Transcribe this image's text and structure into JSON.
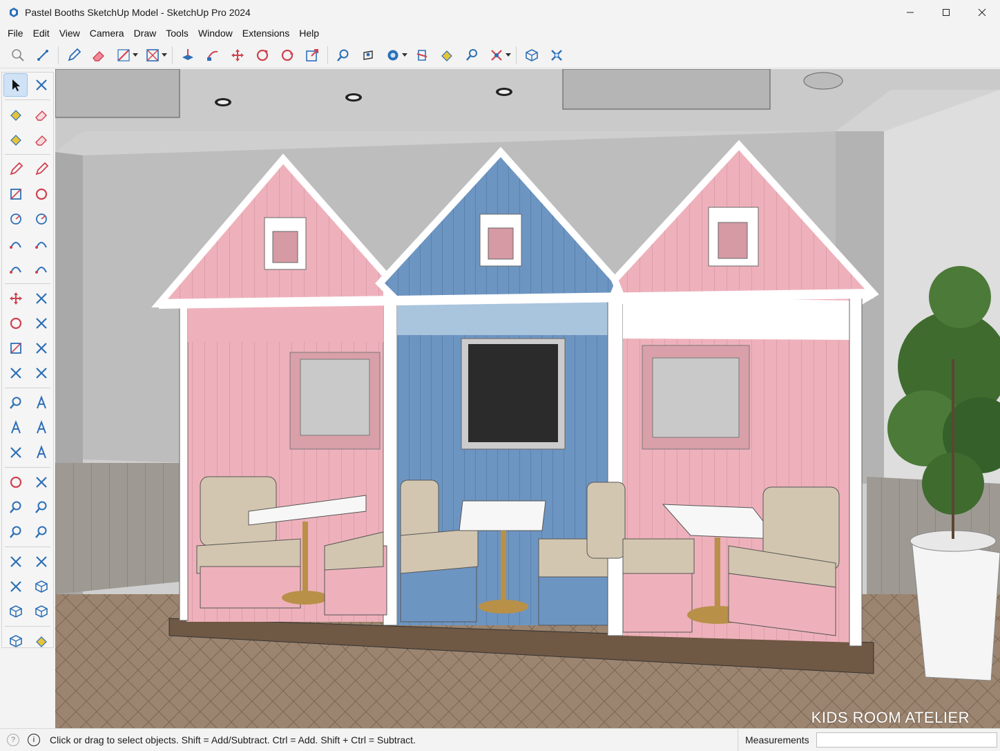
{
  "window": {
    "title": "Pastel Booths SketchUp Model - SketchUp Pro 2024",
    "controls": [
      "minimize",
      "maximize",
      "close"
    ]
  },
  "menubar": {
    "items": [
      "File",
      "Edit",
      "View",
      "Camera",
      "Draw",
      "Tools",
      "Window",
      "Extensions",
      "Help"
    ]
  },
  "toolbar_top": {
    "icons": [
      "search-icon",
      "tape-measure-icon",
      "eraser-icon",
      "line-icon",
      "rectangle-icon",
      "push-pull-icon",
      "follow-me-icon",
      "move-icon",
      "rotate-icon",
      "orbit-icon",
      "scale-icon",
      "zoom-icon",
      "walk-icon",
      "styles-icon",
      "section-plane-icon",
      "paint-bucket-icon",
      "zoom-window-icon",
      "zoom-extents-icon",
      "warehouse-icon",
      "extension-icon"
    ]
  },
  "toolbar_left": {
    "icons": [
      "select-icon",
      "lasso-select-icon",
      "paint-bucket-icon",
      "eraser-icon",
      "tag-paint-icon",
      "tag-eraser-icon",
      "pencil-icon",
      "freehand-icon",
      "rectangle-icon",
      "rotated-rectangle-icon",
      "circle-icon",
      "polygon-icon",
      "arc-icon",
      "pie-icon",
      "two-point-arc-icon",
      "three-point-arc-icon",
      "move-icon",
      "push-pull-icon",
      "rotate-icon",
      "follow-me-icon",
      "scale-icon",
      "offset-icon",
      "flip-icon",
      "solid-tools-icon",
      "tape-measure-icon",
      "dimension-icon",
      "protractor-icon",
      "text-icon",
      "axes-icon",
      "3d-text-icon",
      "orbit-icon",
      "pan-icon",
      "zoom-icon",
      "zoom-window-icon",
      "zoom-extents-icon",
      "look-around-icon",
      "walk-icon",
      "position-camera-icon",
      "section-plane-icon",
      "sandbox-icon",
      "warehouse-icon",
      "extension-warehouse-icon",
      "components-icon",
      "materials-icon"
    ],
    "active": "select-icon"
  },
  "viewport": {
    "watermark": "KIDS ROOM ATELIER",
    "colors": {
      "pink": "#eeb1bb",
      "blue": "#6d95c2",
      "white_trim": "#ffffff",
      "wall": "#bdbdbd",
      "floor": "#a08a74"
    }
  },
  "statusbar": {
    "hint": "Click or drag to select objects. Shift = Add/Subtract. Ctrl = Add. Shift + Ctrl = Subtract.",
    "measurements_label": "Measurements",
    "measurements_value": ""
  }
}
